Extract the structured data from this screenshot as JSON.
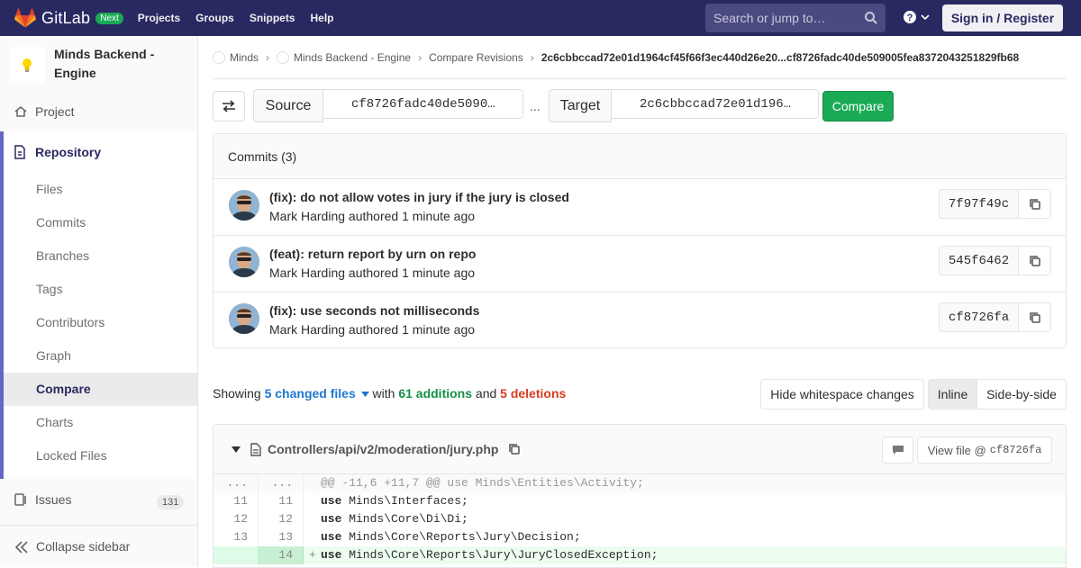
{
  "topbar": {
    "brand": "GitLab",
    "badge": "Next",
    "nav": [
      "Projects",
      "Groups",
      "Snippets",
      "Help"
    ],
    "search_placeholder": "Search or jump to…",
    "signin": "Sign in / Register",
    "colors": {
      "bg": "#292961",
      "accent": "#fc6d26"
    }
  },
  "sidebar": {
    "project_name": "Minds Backend - Engine",
    "project": "Project",
    "repository": "Repository",
    "repo_items": [
      "Files",
      "Commits",
      "Branches",
      "Tags",
      "Contributors",
      "Graph",
      "Compare",
      "Charts",
      "Locked Files"
    ],
    "active_item": "Compare",
    "issues": "Issues",
    "issues_count": "131",
    "collapse": "Collapse sidebar"
  },
  "breadcrumb": {
    "items": [
      "Minds",
      "Minds Backend - Engine",
      "Compare Revisions"
    ],
    "current": "2c6cbbccad72e01d1964cf45f66f3ec440d26e20...cf8726fadc40de509005fea8372043251829fb68"
  },
  "compare": {
    "source_label": "Source",
    "source_value": "cf8726fadc40de5090…",
    "dots": "...",
    "target_label": "Target",
    "target_value": "2c6cbbccad72e01d196…",
    "button": "Compare"
  },
  "commits": {
    "header": "Commits (3)",
    "items": [
      {
        "title": "(fix): do not allow votes in jury if the jury is closed",
        "author": "Mark Harding",
        "meta": "authored 1 minute ago",
        "sha": "7f97f49c"
      },
      {
        "title": "(feat): return report by urn on repo",
        "author": "Mark Harding",
        "meta": "authored 1 minute ago",
        "sha": "545f6462"
      },
      {
        "title": "(fix): use seconds not milliseconds",
        "author": "Mark Harding",
        "meta": "authored 1 minute ago",
        "sha": "cf8726fa"
      }
    ]
  },
  "summary": {
    "showing": "Showing",
    "changed": "5 changed files",
    "with": "with",
    "additions": "61 additions",
    "and": "and",
    "deletions": "5 deletions",
    "ws_button": "Hide whitespace changes",
    "inline": "Inline",
    "side_by_side": "Side-by-side"
  },
  "file": {
    "path": "Controllers/api/v2/moderation/jury.php",
    "view_file": "View file @",
    "view_sha": "cf8726fa",
    "lines": [
      {
        "old": "...",
        "new": "...",
        "type": "hunk",
        "sign": "",
        "kw": "",
        "text": "@@ -11,6 +11,7 @@ use Minds\\Entities\\Activity;"
      },
      {
        "old": "11",
        "new": "11",
        "type": "ctx",
        "sign": "",
        "kw": "use",
        "text": " Minds\\Interfaces;"
      },
      {
        "old": "12",
        "new": "12",
        "type": "ctx",
        "sign": "",
        "kw": "use",
        "text": " Minds\\Core\\Di\\Di;"
      },
      {
        "old": "13",
        "new": "13",
        "type": "ctx",
        "sign": "",
        "kw": "use",
        "text": " Minds\\Core\\Reports\\Jury\\Decision;"
      },
      {
        "old": "",
        "new": "14",
        "type": "add",
        "sign": "+",
        "kw": "use",
        "text": " Minds\\Core\\Reports\\Jury\\JuryClosedException;"
      }
    ]
  }
}
